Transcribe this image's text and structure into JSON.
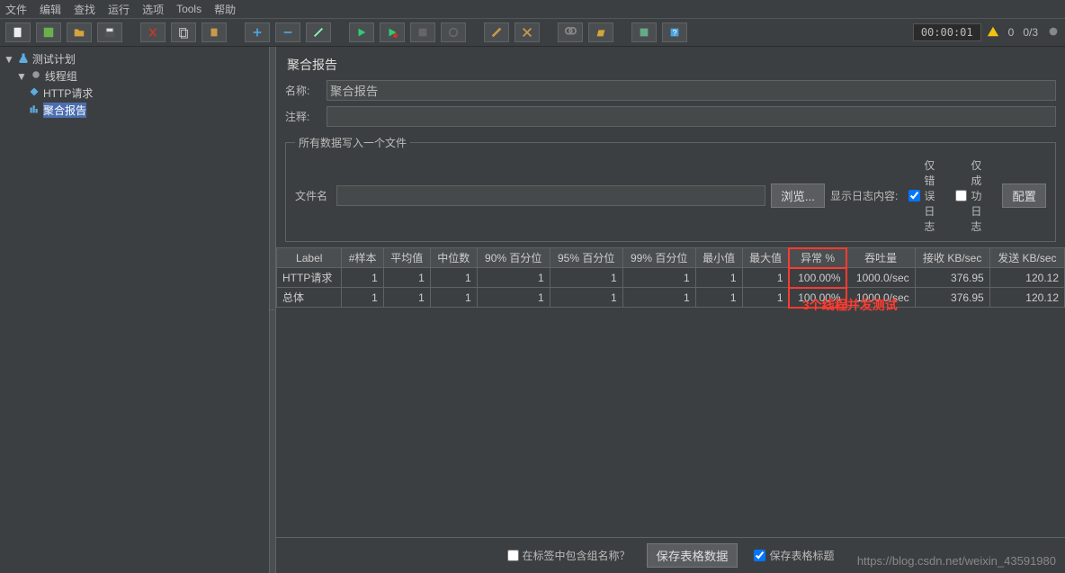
{
  "menu": {
    "file": "文件",
    "edit": "编辑",
    "find": "查找",
    "run": "运行",
    "options": "选项",
    "tools": "Tools",
    "help": "帮助"
  },
  "toolbar_status": {
    "timer": "00:00:01",
    "warn_count": "0",
    "threads": "0/3"
  },
  "tree": {
    "root": "测试计划",
    "threadgroup": "线程组",
    "httprequest": "HTTP请求",
    "aggreport": "聚合报告"
  },
  "panel": {
    "title": "聚合报告",
    "name_label": "名称:",
    "name_value": "聚合报告",
    "comment_label": "注释:",
    "comment_value": "",
    "fileset_legend": "所有数据写入一个文件",
    "filename_label": "文件名",
    "filename_value": "",
    "browse": "浏览...",
    "loglabel": "显示日志内容:",
    "erronly": "仅错误日志",
    "successonly": "仅成功日志",
    "configure": "配置"
  },
  "table": {
    "headers": [
      "Label",
      "#样本",
      "平均值",
      "中位数",
      "90% 百分位",
      "95% 百分位",
      "99% 百分位",
      "最小值",
      "最大值",
      "异常 %",
      "吞吐量",
      "接收 KB/sec",
      "发送 KB/sec"
    ],
    "rows": [
      {
        "label": "HTTP请求",
        "samples": "1",
        "avg": "1",
        "median": "1",
        "p90": "1",
        "p95": "1",
        "p99": "1",
        "min": "1",
        "max": "1",
        "error": "100.00%",
        "throughput": "1000.0/sec",
        "recv": "376.95",
        "sent": "120.12"
      },
      {
        "label": "总体",
        "samples": "1",
        "avg": "1",
        "median": "1",
        "p90": "1",
        "p95": "1",
        "p99": "1",
        "min": "1",
        "max": "1",
        "error": "100.00%",
        "throughput": "1000.0/sec",
        "recv": "376.95",
        "sent": "120.12"
      }
    ],
    "annotation": "3个线程并发测试"
  },
  "bottom": {
    "include_group": "在标签中包含组名称？",
    "save_table": "保存表格数据",
    "save_header": "保存表格标题"
  },
  "watermark": "https://blog.csdn.net/weixin_43591980"
}
